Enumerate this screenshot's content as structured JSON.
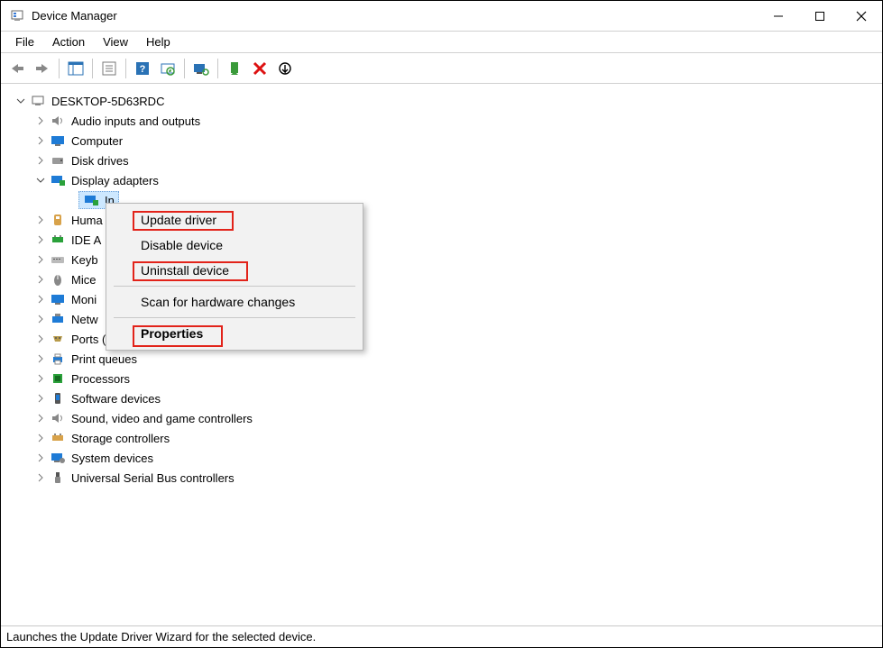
{
  "window": {
    "title": "Device Manager"
  },
  "menu": {
    "file": "File",
    "action": "Action",
    "view": "View",
    "help": "Help"
  },
  "tree": {
    "root": "DESKTOP-5D63RDC",
    "audio": "Audio inputs and outputs",
    "computer": "Computer",
    "disk": "Disk drives",
    "display": "Display adapters",
    "display_child": "In",
    "hid": "Huma",
    "ide": "IDE A",
    "keyboards": "Keyb",
    "mice": "Mice",
    "monitors": "Moni",
    "network": "Netw",
    "ports": "Ports (COM & LPT)",
    "printq": "Print queues",
    "processors": "Processors",
    "software": "Software devices",
    "sound": "Sound, video and game controllers",
    "storage": "Storage controllers",
    "system": "System devices",
    "usb": "Universal Serial Bus controllers"
  },
  "context_menu": {
    "update": "Update driver",
    "disable": "Disable device",
    "uninstall": "Uninstall device",
    "scan": "Scan for hardware changes",
    "properties": "Properties"
  },
  "status": "Launches the Update Driver Wizard for the selected device."
}
